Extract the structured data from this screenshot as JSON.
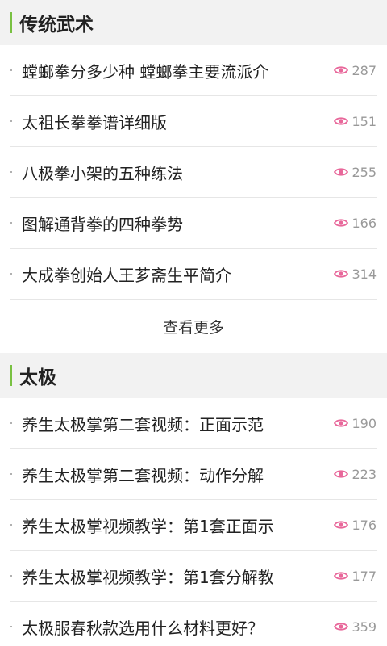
{
  "sections": [
    {
      "title": "传统武术",
      "items": [
        {
          "text": "螳螂拳分多少种 螳螂拳主要流派介",
          "views": "287"
        },
        {
          "text": "太祖长拳拳谱详细版",
          "views": "151"
        },
        {
          "text": "八极拳小架的五种练法",
          "views": "255"
        },
        {
          "text": "图解通背拳的四种拳势",
          "views": "166"
        },
        {
          "text": "大成拳创始人王芗斋生平简介",
          "views": "314"
        }
      ],
      "more_label": "查看更多"
    },
    {
      "title": "太极",
      "items": [
        {
          "text": "养生太极掌第二套视频：正面示范",
          "views": "190"
        },
        {
          "text": "养生太极掌第二套视频：动作分解",
          "views": "223"
        },
        {
          "text": "养生太极掌视频教学：第1套正面示",
          "views": "176"
        },
        {
          "text": "养生太极掌视频教学：第1套分解教",
          "views": "177"
        },
        {
          "text": "太极服春秋款选用什么材料更好？",
          "views": "359"
        }
      ]
    }
  ],
  "colors": {
    "accent": "#79c142",
    "eye_icon": "#e8679a"
  },
  "icons": {
    "views": "eye-icon"
  }
}
